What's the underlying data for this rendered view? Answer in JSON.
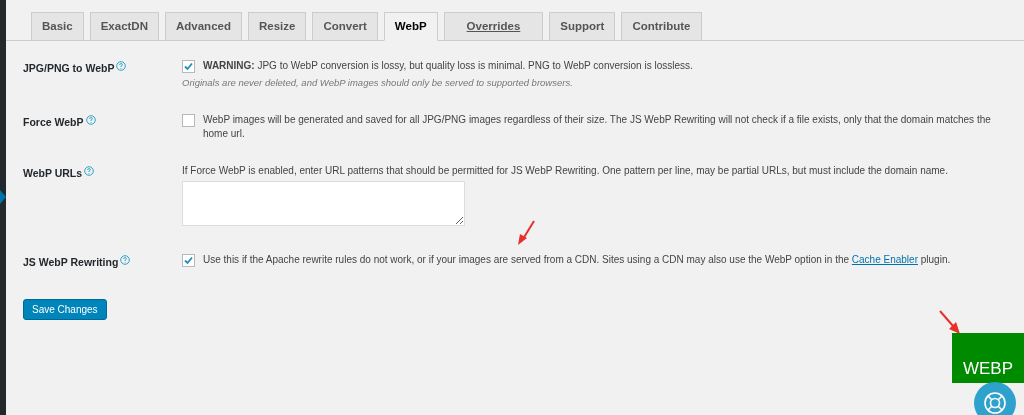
{
  "tabs": [
    {
      "label": "Basic",
      "selected": false,
      "underlined": false
    },
    {
      "label": "ExactDN",
      "selected": false,
      "underlined": false
    },
    {
      "label": "Advanced",
      "selected": false,
      "underlined": false
    },
    {
      "label": "Resize",
      "selected": false,
      "underlined": false
    },
    {
      "label": "Convert",
      "selected": false,
      "underlined": false
    },
    {
      "label": "WebP",
      "selected": true,
      "underlined": false
    },
    {
      "label": "Overrides",
      "selected": false,
      "underlined": true
    },
    {
      "label": "Support",
      "selected": false,
      "underlined": false
    },
    {
      "label": "Contribute",
      "selected": false,
      "underlined": false
    }
  ],
  "settings": [
    {
      "kind": "checkbox",
      "label": "JPG/PNG to WebP",
      "checked": true,
      "text": "**WARNING:** JPG to WebP conversion is lossy, but quality loss is minimal. PNG to WebP conversion is lossless.",
      "note": "Originals are never deleted, and WebP images should only be served to supported browsers."
    },
    {
      "kind": "checkbox",
      "label": "Force WebP",
      "checked": false,
      "text": "WebP images will be generated and saved for all JPG/PNG images regardless of their size. The JS WebP Rewriting will not check if a file exists, only that the domain matches the home url."
    },
    {
      "kind": "textarea",
      "label": "WebP URLs",
      "text": "If Force WebP is enabled, enter URL patterns that should be permitted for JS WebP Rewriting. One pattern per line, may be partial URLs, but must include the domain name."
    },
    {
      "kind": "checkbox",
      "label": "JS WebP Rewriting",
      "checked": true,
      "text": "Use this if the Apache rewrite rules do not work, or if your images are served from a CDN. Sites using a CDN may also use the WebP option in the",
      "link": "Cache Enabler",
      "after": "plugin."
    }
  ],
  "save_button": "Save Changes",
  "badge": "WEBP"
}
